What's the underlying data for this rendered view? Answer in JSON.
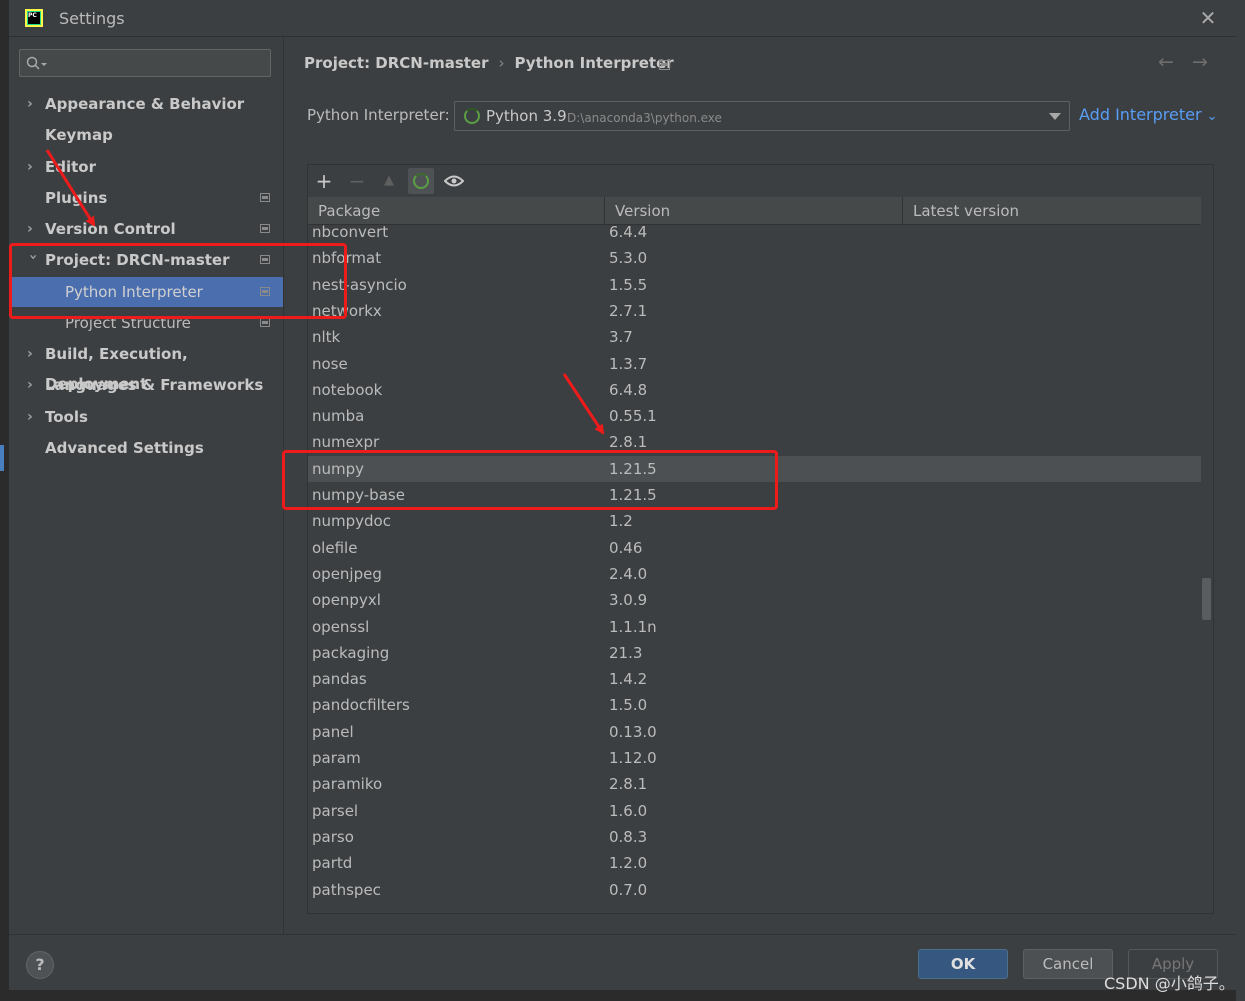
{
  "window": {
    "title": "Settings"
  },
  "sidebar": {
    "items": [
      {
        "label": "Appearance & Behavior",
        "expandable": true
      },
      {
        "label": "Keymap",
        "expandable": false
      },
      {
        "label": "Editor",
        "expandable": true
      },
      {
        "label": "Plugins",
        "expandable": false
      },
      {
        "label": "Version Control",
        "expandable": true
      },
      {
        "label": "Project: DRCN-master",
        "expandable": true,
        "expanded": true
      },
      {
        "label": "Python Interpreter",
        "selected": true
      },
      {
        "label": "Project Structure"
      },
      {
        "label": "Build, Execution, Deployment",
        "expandable": true
      },
      {
        "label": "Languages & Frameworks",
        "expandable": true
      },
      {
        "label": "Tools",
        "expandable": true
      },
      {
        "label": "Advanced Settings",
        "expandable": false
      }
    ]
  },
  "breadcrumb": {
    "project": "Project: DRCN-master",
    "separator": "›",
    "page": "Python Interpreter"
  },
  "interpreter": {
    "label": "Python Interpreter:",
    "name": "Python 3.9",
    "path": "D:\\anaconda3\\python.exe",
    "add_label": "Add Interpreter"
  },
  "table": {
    "columns": [
      "Package",
      "Version",
      "Latest version"
    ],
    "selected_row": "numpy",
    "rows": [
      {
        "package": "nbconvert",
        "version": "6.4.4"
      },
      {
        "package": "nbformat",
        "version": "5.3.0"
      },
      {
        "package": "nest-asyncio",
        "version": "1.5.5"
      },
      {
        "package": "networkx",
        "version": "2.7.1"
      },
      {
        "package": "nltk",
        "version": "3.7"
      },
      {
        "package": "nose",
        "version": "1.3.7"
      },
      {
        "package": "notebook",
        "version": "6.4.8"
      },
      {
        "package": "numba",
        "version": "0.55.1"
      },
      {
        "package": "numexpr",
        "version": "2.8.1"
      },
      {
        "package": "numpy",
        "version": "1.21.5"
      },
      {
        "package": "numpy-base",
        "version": "1.21.5"
      },
      {
        "package": "numpydoc",
        "version": "1.2"
      },
      {
        "package": "olefile",
        "version": "0.46"
      },
      {
        "package": "openjpeg",
        "version": "2.4.0"
      },
      {
        "package": "openpyxl",
        "version": "3.0.9"
      },
      {
        "package": "openssl",
        "version": "1.1.1n"
      },
      {
        "package": "packaging",
        "version": "21.3"
      },
      {
        "package": "pandas",
        "version": "1.4.2"
      },
      {
        "package": "pandocfilters",
        "version": "1.5.0"
      },
      {
        "package": "panel",
        "version": "0.13.0"
      },
      {
        "package": "param",
        "version": "1.12.0"
      },
      {
        "package": "paramiko",
        "version": "2.8.1"
      },
      {
        "package": "parsel",
        "version": "1.6.0"
      },
      {
        "package": "parso",
        "version": "0.8.3"
      },
      {
        "package": "partd",
        "version": "1.2.0"
      },
      {
        "package": "pathspec",
        "version": "0.7.0"
      }
    ]
  },
  "footer": {
    "help": "?",
    "ok": "OK",
    "cancel": "Cancel",
    "apply": "Apply"
  },
  "watermark": "CSDN @小鸽子。",
  "colors": {
    "accent": "#4b6eaf",
    "link": "#589df6",
    "annotation": "#ee1b1b",
    "spinner": "#5b9f45"
  }
}
